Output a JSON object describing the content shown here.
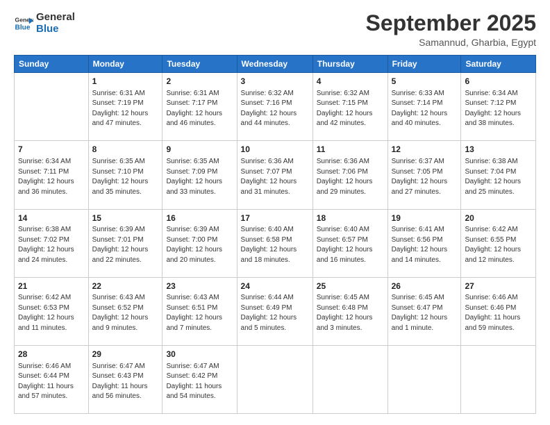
{
  "header": {
    "logo_line1": "General",
    "logo_line2": "Blue",
    "month": "September 2025",
    "location": "Samannud, Gharbia, Egypt"
  },
  "days_of_week": [
    "Sunday",
    "Monday",
    "Tuesday",
    "Wednesday",
    "Thursday",
    "Friday",
    "Saturday"
  ],
  "weeks": [
    [
      {
        "day": "",
        "info": ""
      },
      {
        "day": "1",
        "info": "Sunrise: 6:31 AM\nSunset: 7:19 PM\nDaylight: 12 hours\nand 47 minutes."
      },
      {
        "day": "2",
        "info": "Sunrise: 6:31 AM\nSunset: 7:17 PM\nDaylight: 12 hours\nand 46 minutes."
      },
      {
        "day": "3",
        "info": "Sunrise: 6:32 AM\nSunset: 7:16 PM\nDaylight: 12 hours\nand 44 minutes."
      },
      {
        "day": "4",
        "info": "Sunrise: 6:32 AM\nSunset: 7:15 PM\nDaylight: 12 hours\nand 42 minutes."
      },
      {
        "day": "5",
        "info": "Sunrise: 6:33 AM\nSunset: 7:14 PM\nDaylight: 12 hours\nand 40 minutes."
      },
      {
        "day": "6",
        "info": "Sunrise: 6:34 AM\nSunset: 7:12 PM\nDaylight: 12 hours\nand 38 minutes."
      }
    ],
    [
      {
        "day": "7",
        "info": "Sunrise: 6:34 AM\nSunset: 7:11 PM\nDaylight: 12 hours\nand 36 minutes."
      },
      {
        "day": "8",
        "info": "Sunrise: 6:35 AM\nSunset: 7:10 PM\nDaylight: 12 hours\nand 35 minutes."
      },
      {
        "day": "9",
        "info": "Sunrise: 6:35 AM\nSunset: 7:09 PM\nDaylight: 12 hours\nand 33 minutes."
      },
      {
        "day": "10",
        "info": "Sunrise: 6:36 AM\nSunset: 7:07 PM\nDaylight: 12 hours\nand 31 minutes."
      },
      {
        "day": "11",
        "info": "Sunrise: 6:36 AM\nSunset: 7:06 PM\nDaylight: 12 hours\nand 29 minutes."
      },
      {
        "day": "12",
        "info": "Sunrise: 6:37 AM\nSunset: 7:05 PM\nDaylight: 12 hours\nand 27 minutes."
      },
      {
        "day": "13",
        "info": "Sunrise: 6:38 AM\nSunset: 7:04 PM\nDaylight: 12 hours\nand 25 minutes."
      }
    ],
    [
      {
        "day": "14",
        "info": "Sunrise: 6:38 AM\nSunset: 7:02 PM\nDaylight: 12 hours\nand 24 minutes."
      },
      {
        "day": "15",
        "info": "Sunrise: 6:39 AM\nSunset: 7:01 PM\nDaylight: 12 hours\nand 22 minutes."
      },
      {
        "day": "16",
        "info": "Sunrise: 6:39 AM\nSunset: 7:00 PM\nDaylight: 12 hours\nand 20 minutes."
      },
      {
        "day": "17",
        "info": "Sunrise: 6:40 AM\nSunset: 6:58 PM\nDaylight: 12 hours\nand 18 minutes."
      },
      {
        "day": "18",
        "info": "Sunrise: 6:40 AM\nSunset: 6:57 PM\nDaylight: 12 hours\nand 16 minutes."
      },
      {
        "day": "19",
        "info": "Sunrise: 6:41 AM\nSunset: 6:56 PM\nDaylight: 12 hours\nand 14 minutes."
      },
      {
        "day": "20",
        "info": "Sunrise: 6:42 AM\nSunset: 6:55 PM\nDaylight: 12 hours\nand 12 minutes."
      }
    ],
    [
      {
        "day": "21",
        "info": "Sunrise: 6:42 AM\nSunset: 6:53 PM\nDaylight: 12 hours\nand 11 minutes."
      },
      {
        "day": "22",
        "info": "Sunrise: 6:43 AM\nSunset: 6:52 PM\nDaylight: 12 hours\nand 9 minutes."
      },
      {
        "day": "23",
        "info": "Sunrise: 6:43 AM\nSunset: 6:51 PM\nDaylight: 12 hours\nand 7 minutes."
      },
      {
        "day": "24",
        "info": "Sunrise: 6:44 AM\nSunset: 6:49 PM\nDaylight: 12 hours\nand 5 minutes."
      },
      {
        "day": "25",
        "info": "Sunrise: 6:45 AM\nSunset: 6:48 PM\nDaylight: 12 hours\nand 3 minutes."
      },
      {
        "day": "26",
        "info": "Sunrise: 6:45 AM\nSunset: 6:47 PM\nDaylight: 12 hours\nand 1 minute."
      },
      {
        "day": "27",
        "info": "Sunrise: 6:46 AM\nSunset: 6:46 PM\nDaylight: 11 hours\nand 59 minutes."
      }
    ],
    [
      {
        "day": "28",
        "info": "Sunrise: 6:46 AM\nSunset: 6:44 PM\nDaylight: 11 hours\nand 57 minutes."
      },
      {
        "day": "29",
        "info": "Sunrise: 6:47 AM\nSunset: 6:43 PM\nDaylight: 11 hours\nand 56 minutes."
      },
      {
        "day": "30",
        "info": "Sunrise: 6:47 AM\nSunset: 6:42 PM\nDaylight: 11 hours\nand 54 minutes."
      },
      {
        "day": "",
        "info": ""
      },
      {
        "day": "",
        "info": ""
      },
      {
        "day": "",
        "info": ""
      },
      {
        "day": "",
        "info": ""
      }
    ]
  ]
}
